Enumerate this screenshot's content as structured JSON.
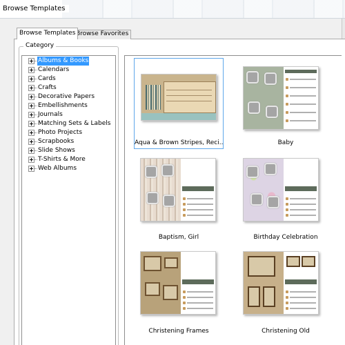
{
  "window": {
    "title": "Browse Templates"
  },
  "tabs": [
    {
      "label": "Browse Templates",
      "active": true
    },
    {
      "label": "Browse Favorites",
      "active": false
    }
  ],
  "category": {
    "group_label": "Category",
    "items": [
      {
        "label": "Albums & Books",
        "selected": true
      },
      {
        "label": "Calendars"
      },
      {
        "label": "Cards"
      },
      {
        "label": "Crafts"
      },
      {
        "label": "Decorative Papers"
      },
      {
        "label": "Embellishments"
      },
      {
        "label": "Journals"
      },
      {
        "label": "Matching Sets & Labels"
      },
      {
        "label": "Photo Projects"
      },
      {
        "label": "Scrapbooks"
      },
      {
        "label": "Slide Shows"
      },
      {
        "label": "T-Shirts & More"
      },
      {
        "label": "Web Albums"
      }
    ]
  },
  "templates": [
    {
      "name": "Aqua & Brown Stripes, Reci...",
      "selected": true
    },
    {
      "name": "Baby"
    },
    {
      "name": "Baptism, Girl"
    },
    {
      "name": "Birthday Celebration"
    },
    {
      "name": "Christening Frames"
    },
    {
      "name": "Christening Old"
    }
  ],
  "colors": {
    "selection": "#3399ff",
    "card_border": "#5ea6ea",
    "tab_border": "#a9a9a9"
  }
}
